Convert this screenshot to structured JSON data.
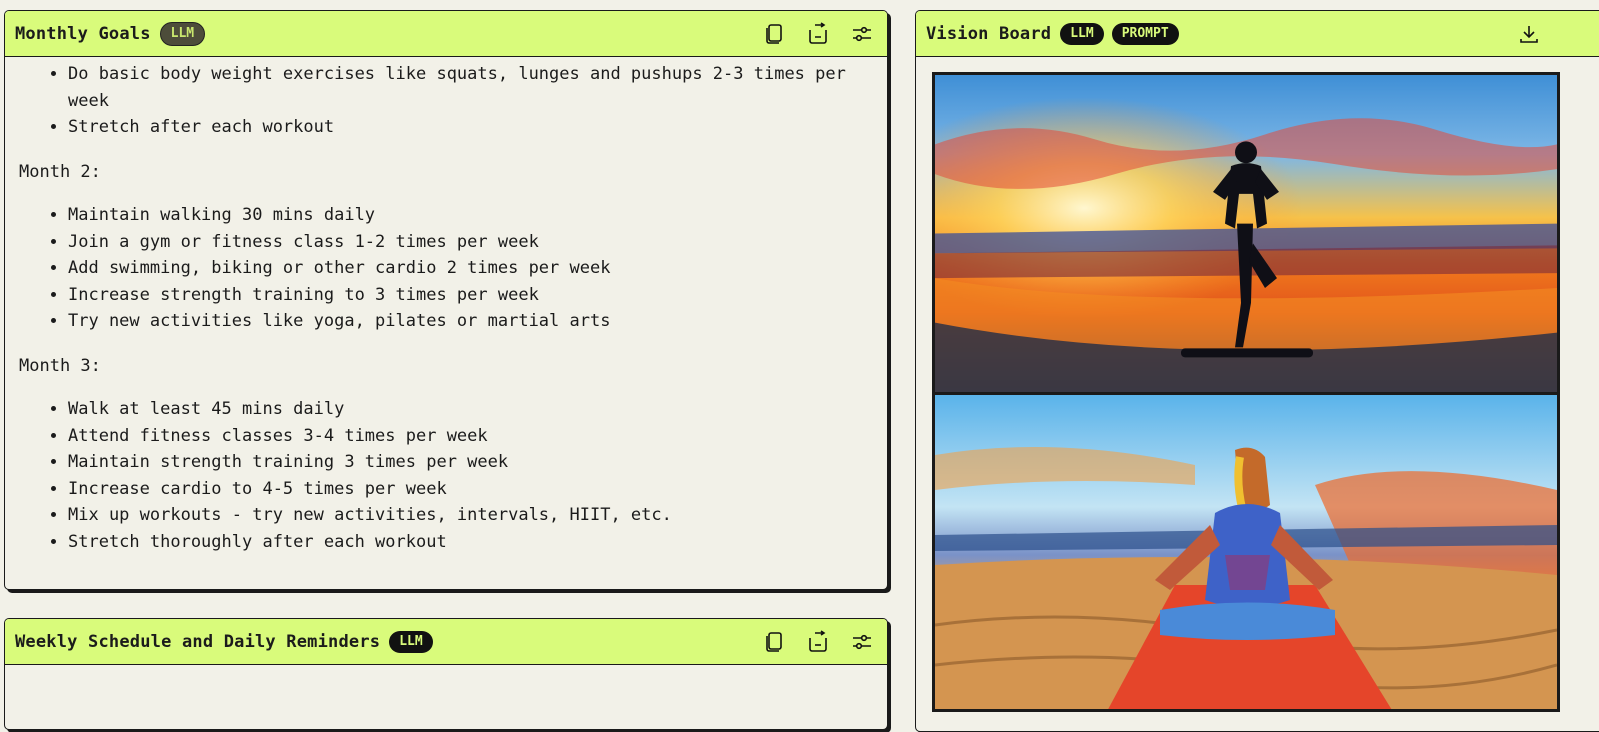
{
  "monthly_goals": {
    "title": "Monthly Goals",
    "badge": "LLM",
    "top_partial_items": [
      "Do basic body weight exercises like squats, lunges and pushups 2-3 times per week",
      "Stretch after each workout"
    ],
    "month2": {
      "heading": "Month 2:",
      "items": [
        "Maintain walking 30 mins daily",
        "Join a gym or fitness class 1-2 times per week",
        "Add swimming, biking or other cardio 2 times per week",
        "Increase strength training to 3 times per week",
        "Try new activities like yoga, pilates or martial arts"
      ]
    },
    "month3": {
      "heading": "Month 3:",
      "items": [
        "Walk at least 45 mins daily",
        "Attend fitness classes 3-4 times per week",
        "Maintain strength training 3 times per week",
        "Increase cardio to 4-5 times per week",
        "Mix up workouts - try new activities, intervals, HIIT, etc.",
        "Stretch thoroughly after each workout"
      ]
    }
  },
  "weekly_schedule": {
    "title": "Weekly Schedule and Daily Reminders",
    "badge": "LLM"
  },
  "vision_board": {
    "title": "Vision Board",
    "badge_llm": "LLM",
    "badge_prompt": "PROMPT"
  },
  "icons": {
    "copy": "copy-icon",
    "share": "share-icon",
    "settings": "sliders-icon",
    "download": "download-icon"
  },
  "colors": {
    "header_accent": "#d9fb7b",
    "panel_bg": "#f2f1e8",
    "border": "#1a1a1a"
  }
}
